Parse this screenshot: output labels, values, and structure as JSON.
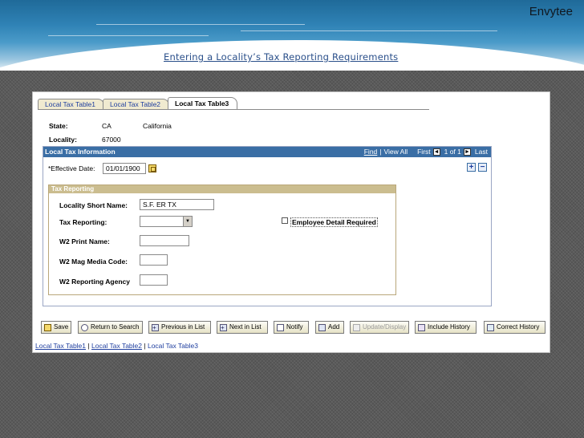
{
  "slide": {
    "brand": "Envytee",
    "title": "Entering a Locality’s Tax Reporting Requirements"
  },
  "tabs": [
    {
      "label": "Local Tax Table1",
      "active": false
    },
    {
      "label": "Local Tax Table2",
      "active": false
    },
    {
      "label": "Local Tax Table3",
      "active": true
    }
  ],
  "header": {
    "state_label": "State:",
    "state_code": "CA",
    "state_name": "California",
    "locality_label": "Locality:",
    "locality_value": "67000"
  },
  "section": {
    "title": "Local Tax Information",
    "find": "Find",
    "sep": "|",
    "view_all": "View All",
    "first": "First",
    "counter": "1 of 1",
    "last": "Last",
    "add_row": "+",
    "delete_row": "−"
  },
  "effective_date": {
    "label": "*Effective Date:",
    "value": "01/01/1900"
  },
  "tax_reporting": {
    "title": "Tax Reporting",
    "short_name_label": "Locality Short Name:",
    "short_name_value": "S.F. ER TX",
    "tax_reporting_label": "Tax Reporting:",
    "tax_reporting_value": "",
    "employee_detail_label": "Employee Detail Required",
    "w2_print_label": "W2 Print Name:",
    "w2_print_value": "",
    "w2_mag_label": "W2 Mag Media Code:",
    "w2_mag_value": "",
    "w2_agency_label": "W2 Reporting Agency",
    "w2_agency_value": ""
  },
  "toolbar": {
    "save": "Save",
    "return_to_search": "Return to Search",
    "previous_in_list": "Previous in List",
    "next_in_list": "Next in List",
    "notify": "Notify",
    "add": "Add",
    "update_display": "Update/Display",
    "include_history": "Include History",
    "correct_history": "Correct History"
  },
  "footer_links": {
    "link1": "Local Tax Table1",
    "link2": "Local Tax Table2",
    "current": "Local Tax Table3",
    "sep": "|"
  }
}
